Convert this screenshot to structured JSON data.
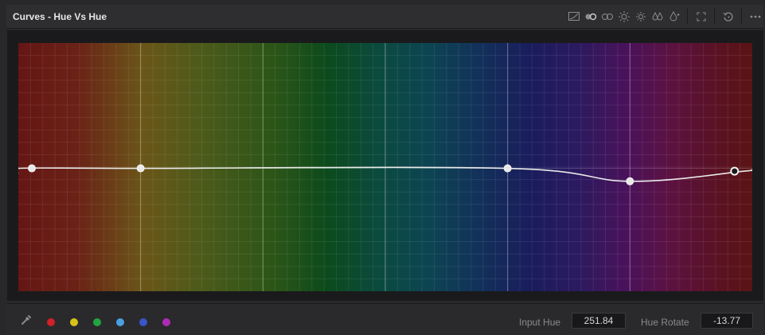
{
  "header": {
    "title": "Curves - Hue Vs Hue"
  },
  "toolbar": {
    "groups": [
      [
        "graph-icon",
        "color-wheels-icon",
        "ring-icon",
        "halo-icon",
        "sun-icon",
        "twin-drops-icon",
        "drop-icon"
      ],
      [
        "expand-icon"
      ],
      [
        "reset-icon"
      ],
      [
        "more-icon"
      ]
    ]
  },
  "graph": {
    "control_points": [
      {
        "hue": 0,
        "rotate": 0
      },
      {
        "hue": 60,
        "rotate": 0
      },
      {
        "hue": 240,
        "rotate": 0
      },
      {
        "hue": 300,
        "rotate": -13.77
      },
      {
        "hue": 356,
        "rotate": -3
      }
    ],
    "curve_color": "#e9e9e9"
  },
  "footer": {
    "swatches": [
      {
        "name": "red",
        "color": "#d0202a"
      },
      {
        "name": "yellow",
        "color": "#d8c21a"
      },
      {
        "name": "green",
        "color": "#1fa640"
      },
      {
        "name": "cyan",
        "color": "#4a9fe0"
      },
      {
        "name": "blue",
        "color": "#3a55c8"
      },
      {
        "name": "magenta",
        "color": "#b02ab8"
      }
    ],
    "input_hue_label": "Input Hue",
    "input_hue_value": "251.84",
    "hue_rotate_label": "Hue Rotate",
    "hue_rotate_value": "-13.77"
  }
}
